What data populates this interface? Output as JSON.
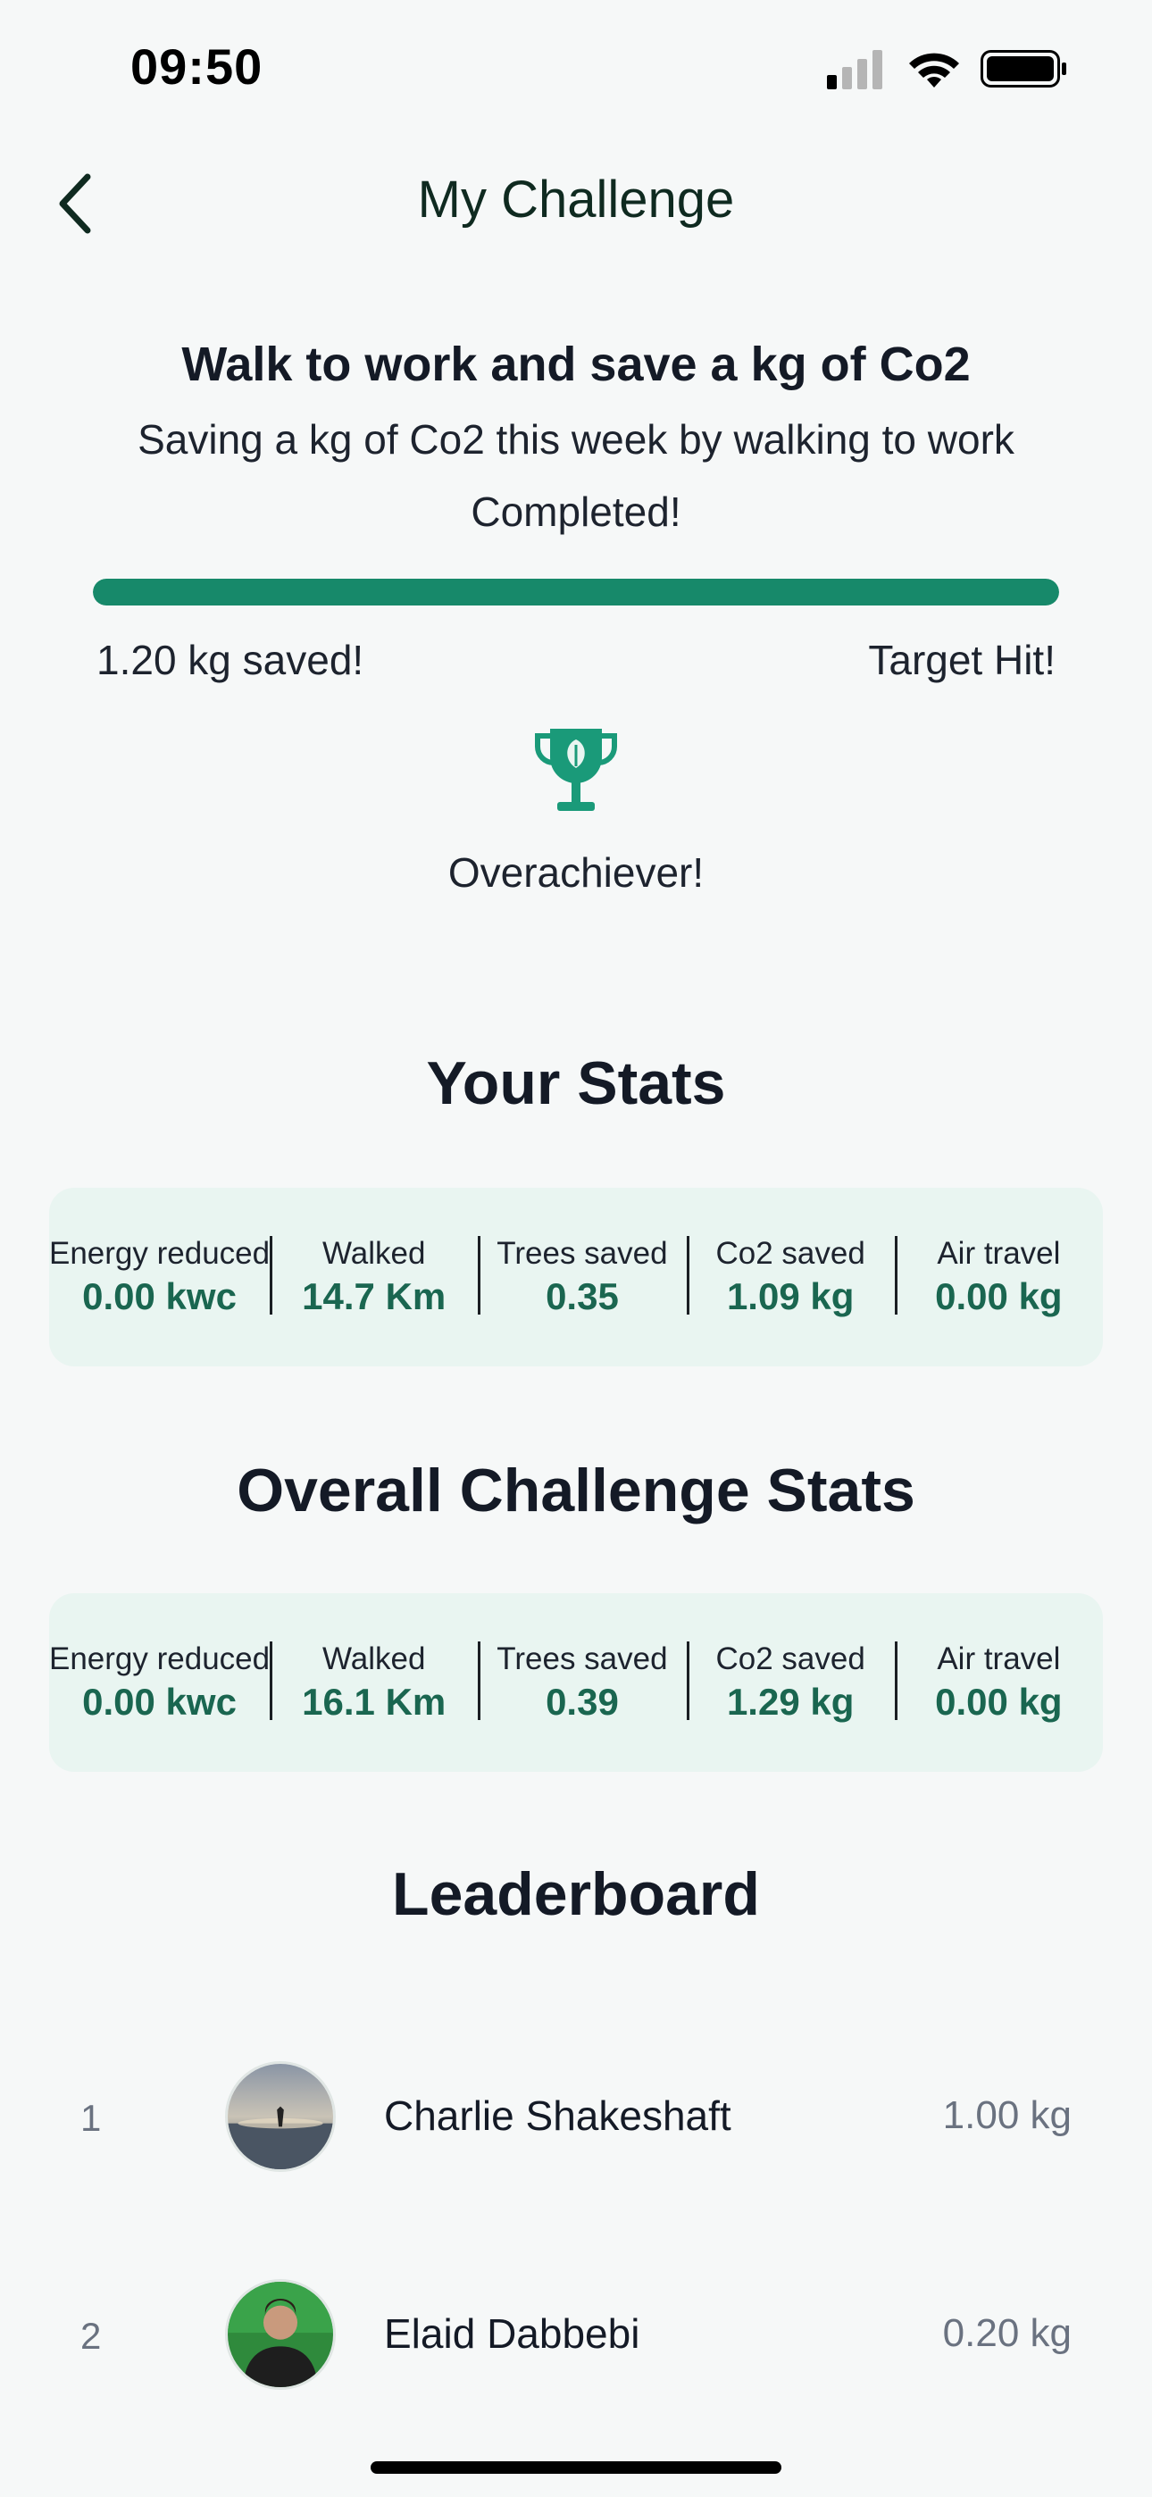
{
  "status_bar": {
    "time": "09:50",
    "battery_level": 1.0,
    "signal_bars_active": 1
  },
  "header": {
    "title": "My Challenge",
    "back_icon": "chevron-left-icon"
  },
  "challenge": {
    "title": "Walk to work and save a kg of Co2",
    "description": "Saving a kg of Co2 this week by walking to work",
    "status": "Completed!",
    "progress": 1.0,
    "saved_label": "1.20 kg saved!",
    "target_label": "Target Hit!",
    "badge_icon": "trophy-leaf-icon",
    "badge_label": "Overachiever!"
  },
  "your_stats": {
    "title": "Your Stats",
    "items": [
      {
        "label": "Energy reduced",
        "value": "0.00 kwc"
      },
      {
        "label": "Walked",
        "value": "14.7 Km"
      },
      {
        "label": "Trees saved",
        "value": "0.35"
      },
      {
        "label": "Co2 saved",
        "value": "1.09 kg"
      },
      {
        "label": "Air travel",
        "value": "0.00 kg"
      }
    ]
  },
  "overall_stats": {
    "title": "Overall Challenge Stats",
    "items": [
      {
        "label": "Energy reduced",
        "value": "0.00 kwc"
      },
      {
        "label": "Walked",
        "value": "16.1 Km"
      },
      {
        "label": "Trees saved",
        "value": "0.39"
      },
      {
        "label": "Co2 saved",
        "value": "1.29 kg"
      },
      {
        "label": "Air travel",
        "value": "0.00 kg"
      }
    ]
  },
  "leaderboard": {
    "title": "Leaderboard",
    "entries": [
      {
        "rank": "1",
        "name": "Charlie Shakeshaft",
        "value": "1.00 kg"
      },
      {
        "rank": "2",
        "name": "Elaid Dabbebi",
        "value": "0.20 kg"
      }
    ]
  },
  "colors": {
    "accent": "#17896a",
    "accent_dark": "#1a6650",
    "card_bg": "#e9f5f1",
    "page_bg": "#f6f8f8"
  }
}
